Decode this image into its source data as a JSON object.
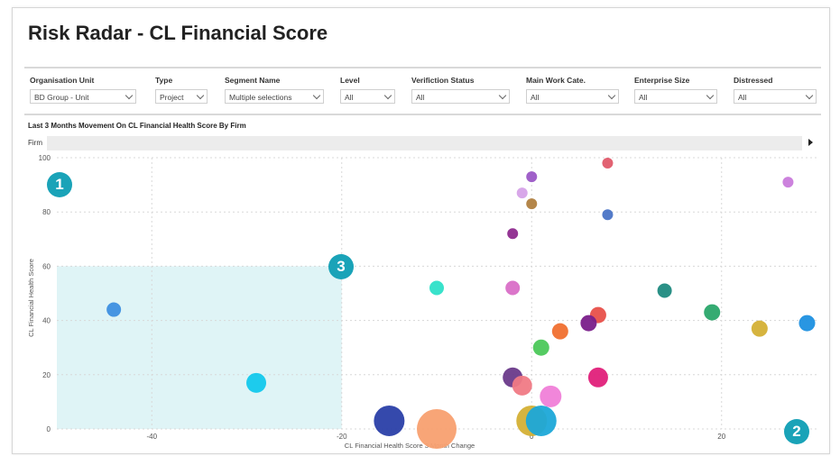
{
  "title": "Risk Radar - CL Financial Score",
  "filters": [
    {
      "label": "Organisation Unit",
      "value": "BD Group - Unit"
    },
    {
      "label": "Type",
      "value": "Project"
    },
    {
      "label": "Segment Name",
      "value": "Multiple selections"
    },
    {
      "label": "Level",
      "value": "All"
    },
    {
      "label": "Verifiction Status",
      "value": "All"
    },
    {
      "label": "Main Work Cate.",
      "value": "All"
    },
    {
      "label": "Enterprise Size",
      "value": "All"
    },
    {
      "label": "Distressed",
      "value": "All"
    }
  ],
  "chart_title": "Last 3 Months Movement On CL Financial Health Score By Firm",
  "firm_label": "Firm",
  "badges": [
    "1",
    "2",
    "3"
  ],
  "chart_data": {
    "type": "scatter",
    "title": "Last 3 Months Movement On CL Financial Health Score By Firm",
    "xlabel": "CL Financial Health Score 3 Month Change",
    "ylabel": "CL Financial Health Score",
    "xlim": [
      -50,
      30
    ],
    "ylim": [
      0,
      100
    ],
    "xticks": [
      -40,
      -20,
      0,
      20
    ],
    "yticks": [
      0,
      20,
      40,
      60,
      80,
      100
    ],
    "xtick_labels": [
      "-40",
      "-20",
      "0",
      "20"
    ],
    "ytick_labels": [
      "0",
      "20",
      "40",
      "60",
      "80",
      "100"
    ],
    "grid": true,
    "highlight_region": {
      "x": [
        -50,
        -20
      ],
      "y": [
        0,
        60
      ],
      "color": "#dff4f6"
    },
    "points": [
      {
        "x": 8,
        "y": 98,
        "size": 6,
        "color": "#e05a6a"
      },
      {
        "x": 0,
        "y": 93,
        "size": 6,
        "color": "#9b59c6"
      },
      {
        "x": 27,
        "y": 91,
        "size": 6,
        "color": "#c97bdb"
      },
      {
        "x": -1,
        "y": 87,
        "size": 6,
        "color": "#d6a2e8"
      },
      {
        "x": 0,
        "y": 83,
        "size": 6,
        "color": "#b08040"
      },
      {
        "x": 8,
        "y": 79,
        "size": 6,
        "color": "#4a74c6"
      },
      {
        "x": -2,
        "y": 72,
        "size": 6,
        "color": "#8e2a8e"
      },
      {
        "x": -10,
        "y": 52,
        "size": 8,
        "color": "#2ee0c8"
      },
      {
        "x": -2,
        "y": 52,
        "size": 8,
        "color": "#d96fc7"
      },
      {
        "x": 14,
        "y": 51,
        "size": 8,
        "color": "#1f8a80"
      },
      {
        "x": -44,
        "y": 44,
        "size": 8,
        "color": "#3d8fe0"
      },
      {
        "x": 19,
        "y": 43,
        "size": 9,
        "color": "#2aa76a"
      },
      {
        "x": 7,
        "y": 42,
        "size": 9,
        "color": "#e8504a"
      },
      {
        "x": 6,
        "y": 39,
        "size": 9,
        "color": "#7a1f8a"
      },
      {
        "x": 29,
        "y": 39,
        "size": 9,
        "color": "#1e90e0"
      },
      {
        "x": 24,
        "y": 37,
        "size": 9,
        "color": "#d4b035"
      },
      {
        "x": 3,
        "y": 36,
        "size": 9,
        "color": "#f07030"
      },
      {
        "x": 1,
        "y": 30,
        "size": 9,
        "color": "#4cc85a"
      },
      {
        "x": -2,
        "y": 19,
        "size": 11,
        "color": "#6a3a8a"
      },
      {
        "x": 7,
        "y": 19,
        "size": 11,
        "color": "#e0207a"
      },
      {
        "x": -29,
        "y": 17,
        "size": 11,
        "color": "#12c8ec"
      },
      {
        "x": -1,
        "y": 16,
        "size": 11,
        "color": "#f07a85"
      },
      {
        "x": 2,
        "y": 12,
        "size": 12,
        "color": "#f080d8"
      },
      {
        "x": -15,
        "y": 3,
        "size": 17,
        "color": "#2a3fa8"
      },
      {
        "x": -10,
        "y": 0,
        "size": 22,
        "color": "#f8a070"
      },
      {
        "x": 0,
        "y": 3,
        "size": 17,
        "color": "#d4b035"
      },
      {
        "x": 1,
        "y": 3,
        "size": 17,
        "color": "#1ca8d8"
      }
    ]
  }
}
